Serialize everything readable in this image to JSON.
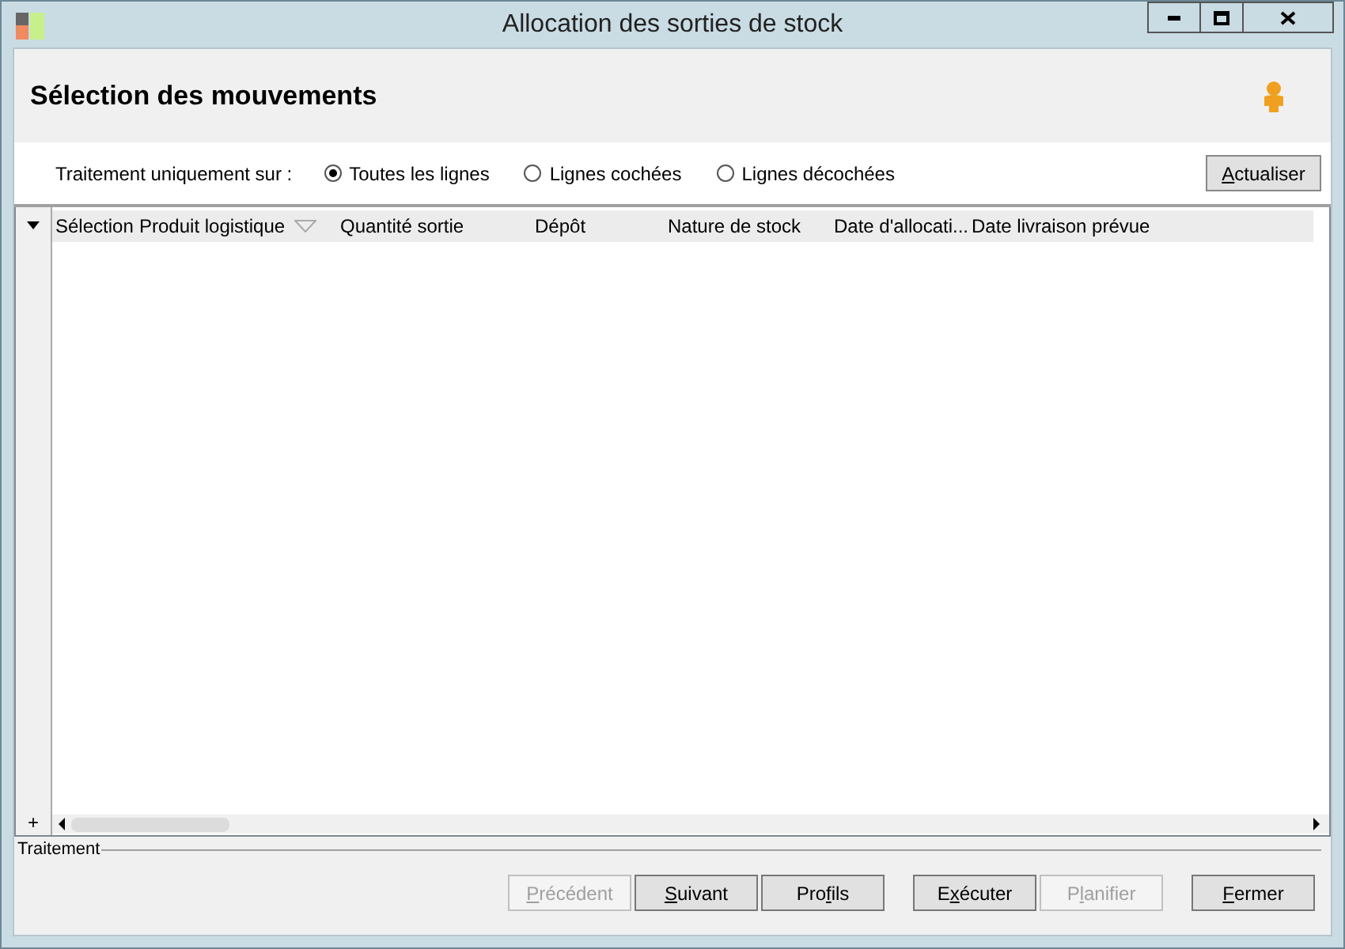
{
  "window": {
    "title": "Allocation des sorties de stock"
  },
  "header": {
    "title": "Sélection des mouvements"
  },
  "filter": {
    "label": "Traitement uniquement sur :",
    "options": [
      {
        "label": "Toutes les lignes",
        "selected": true
      },
      {
        "label": "Lignes cochées",
        "selected": false
      },
      {
        "label": "Lignes décochées",
        "selected": false
      }
    ],
    "refresh_button": {
      "key": "A",
      "post": "ctualiser"
    }
  },
  "table": {
    "columns": [
      {
        "label": "Sélection",
        "sorted": false
      },
      {
        "label": "Produit logistique",
        "sorted": true
      },
      {
        "label": "Quantité sortie",
        "sorted": false
      },
      {
        "label": "Dépôt",
        "sorted": false
      },
      {
        "label": "Nature de stock",
        "sorted": false
      },
      {
        "label": "Date d'allocati...",
        "sorted": false
      },
      {
        "label": "Date livraison prévue",
        "sorted": false
      }
    ],
    "add_symbol": "+"
  },
  "footer": {
    "group_label": "Traitement",
    "buttons": [
      {
        "key": "P",
        "post": "récédent",
        "disabled": true
      },
      {
        "key": "S",
        "post": "uivant",
        "disabled": false
      },
      {
        "pre": "Pro",
        "key": "f",
        "post": "ils",
        "disabled": false
      },
      {
        "pre": "E",
        "key": "x",
        "post": "écuter",
        "disabled": false
      },
      {
        "pre": "P",
        "key": "l",
        "post": "anifier",
        "disabled": true
      },
      {
        "key": "F",
        "post": "ermer",
        "disabled": false
      }
    ]
  }
}
